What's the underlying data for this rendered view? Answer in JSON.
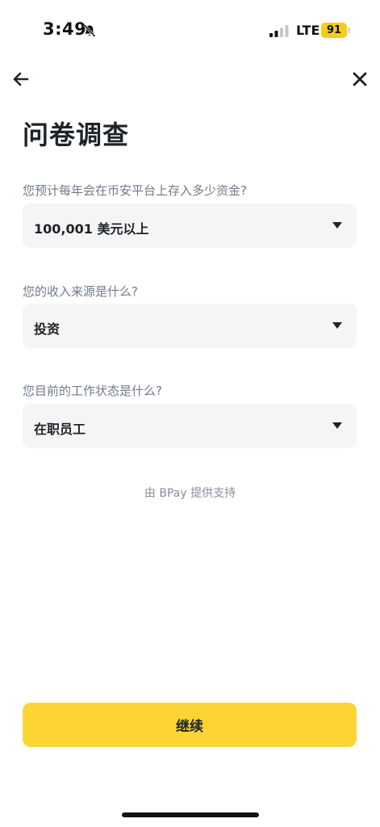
{
  "status_bar": {
    "time": "3:49",
    "network": "LTE",
    "battery": "91",
    "icons": [
      "bell-slash-icon",
      "signal-icon"
    ],
    "battery_color": "#f5ce16"
  },
  "nav": {
    "back_icon": "arrow-left-icon",
    "close_icon": "close-icon"
  },
  "page": {
    "title": "问卷调查"
  },
  "questions": [
    {
      "label": "您预计每年会在币安平台上存入多少资金?",
      "selected": "100,001 美元以上"
    },
    {
      "label": "您的收入来源是什么?",
      "selected": "投资"
    },
    {
      "label": "您目前的工作状态是什么?",
      "selected": "在职员工"
    }
  ],
  "footer": {
    "powered_by": "由 BPay 提供支持",
    "continue_label": "继续"
  },
  "colors": {
    "accent": "#fcd535",
    "field_bg": "#f5f5f5",
    "muted_text": "#707a8a",
    "primary_text": "#1e2329"
  }
}
